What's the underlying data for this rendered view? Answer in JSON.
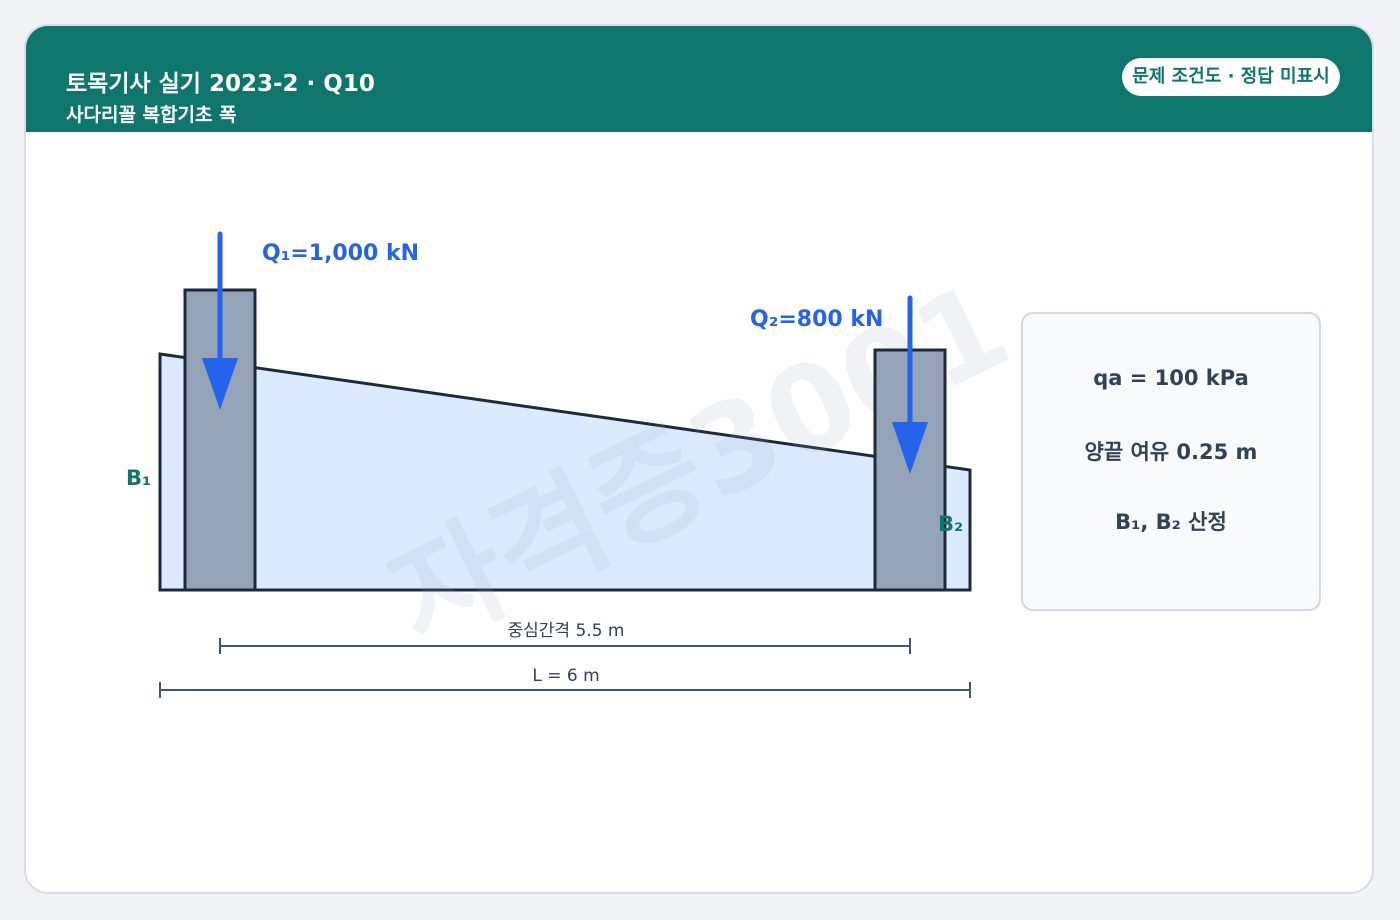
{
  "header": {
    "title": "토목기사 실기 2023-2 · Q10",
    "subtitle": "사다리꼴 복합기초 폭",
    "badge": "문제 조건도 · 정답 미표시"
  },
  "diagram": {
    "load1": "Q₁=1,000 kN",
    "load2": "Q₂=800 kN",
    "width1": "B₁",
    "width2": "B₂",
    "center_spacing": "중심간격 5.5 m",
    "total_length": "L = 6 m",
    "watermark": "자격증3001"
  },
  "conditions": {
    "line1": "qa = 100 kPa",
    "line2": "양끝 여유 0.25 m",
    "line3": "B₁, B₂ 산정"
  },
  "colors": {
    "header": "#0f766e",
    "load_arrow": "#2563eb",
    "footing_fill": "#dbeafe",
    "column_fill": "#94a3b8",
    "outline": "#1e293b",
    "width_label": "#0f766e"
  }
}
